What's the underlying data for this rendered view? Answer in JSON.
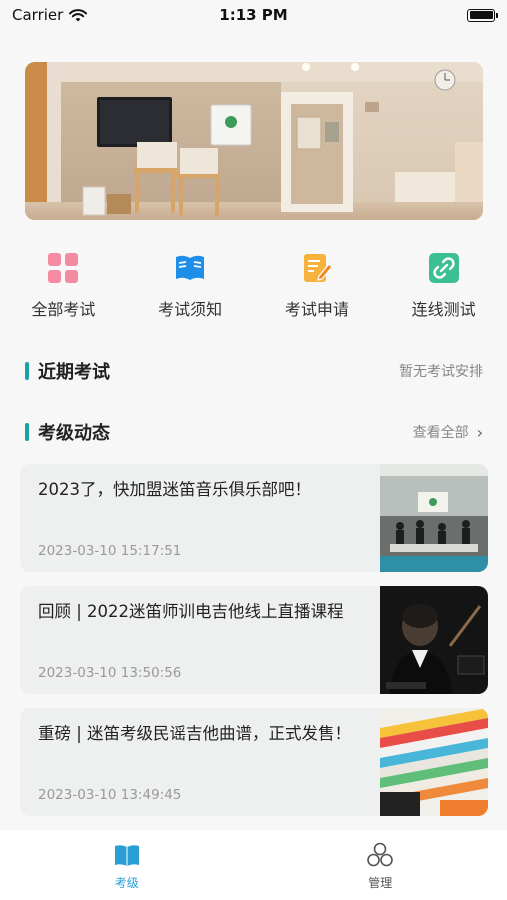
{
  "status_bar": {
    "carrier": "Carrier",
    "time": "1:13 PM"
  },
  "quick_menu": [
    {
      "label": "全部考试",
      "icon": "grid-icon"
    },
    {
      "label": "考试须知",
      "icon": "book-icon"
    },
    {
      "label": "考试申请",
      "icon": "edit-icon"
    },
    {
      "label": "连线测试",
      "icon": "link-icon"
    }
  ],
  "recent_exams": {
    "title": "近期考试",
    "status": "暂无考试安排"
  },
  "news_section": {
    "title": "考级动态",
    "view_all": "查看全部"
  },
  "news": [
    {
      "title": "2023了，快加盟迷笛音乐俱乐部吧！",
      "date": "2023-03-10 15:17:51"
    },
    {
      "title": "回顾 | 2022迷笛师训电吉他线上直播课程",
      "date": "2023-03-10 13:50:56"
    },
    {
      "title": "重磅 | 迷笛考级民谣吉他曲谱，正式发售！",
      "date": "2023-03-10 13:49:45"
    }
  ],
  "tab_bar": [
    {
      "label": "考级",
      "icon": "book-icon",
      "active": true
    },
    {
      "label": "管理",
      "icon": "cluster-icon",
      "active": false
    }
  ],
  "colors": {
    "accent": "#17a2a8",
    "active_tab": "#2a9fd6",
    "inactive_tab": "#555555"
  }
}
